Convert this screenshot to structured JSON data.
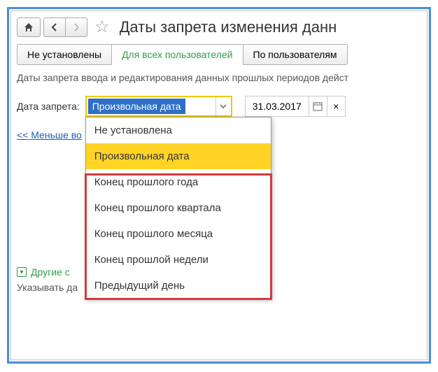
{
  "header": {
    "title": "Даты запрета изменения данн"
  },
  "tabs": [
    {
      "label": "Не установлены"
    },
    {
      "label": "Для всех пользователей"
    },
    {
      "label": "По пользователям"
    }
  ],
  "description": "Даты запрета ввода и редактирования данных прошлых периодов дейст",
  "field": {
    "label": "Дата запрета:",
    "value": "Произвольная дата",
    "date_value": "31.03.2017"
  },
  "dropdown_items": [
    "Не установлена",
    "Произвольная дата",
    "Конец прошлого года",
    "Конец прошлого квартала",
    "Конец прошлого месяца",
    "Конец прошлой недели",
    "Предыдущий день"
  ],
  "link_text": "<< Меньше во",
  "section": {
    "title": "Другие с",
    "sub": "Указывать да"
  }
}
